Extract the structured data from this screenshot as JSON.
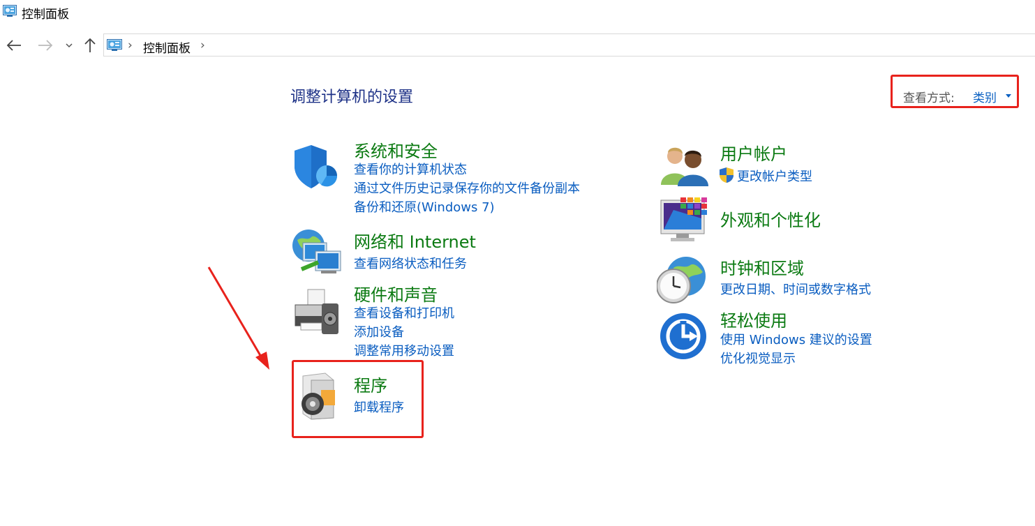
{
  "window": {
    "title": "控制面板"
  },
  "nav": {
    "breadcrumb": [
      "控制面板"
    ]
  },
  "main": {
    "page_title": "调整计算机的设置",
    "view_by": {
      "label": "查看方式:",
      "value": "类别"
    },
    "categories": [
      {
        "title": "系统和安全",
        "icon": "shield-icon",
        "links": [
          "查看你的计算机状态",
          "通过文件历史记录保存你的文件备份副本",
          "备份和还原(Windows 7)"
        ]
      },
      {
        "title": "网络和 Internet",
        "icon": "network-icon",
        "links": [
          "查看网络状态和任务"
        ]
      },
      {
        "title": "硬件和声音",
        "icon": "printer-icon",
        "links": [
          "查看设备和打印机",
          "添加设备",
          "调整常用移动设置"
        ]
      },
      {
        "title": "程序",
        "icon": "programs-icon",
        "links": [
          "卸载程序"
        ]
      },
      {
        "title": "用户帐户",
        "icon": "users-icon",
        "links": [
          "更改帐户类型"
        ]
      },
      {
        "title": "外观和个性化",
        "icon": "monitor-icon",
        "links": []
      },
      {
        "title": "时钟和区域",
        "icon": "clock-icon",
        "links": [
          "更改日期、时间或数字格式"
        ]
      },
      {
        "title": "轻松使用",
        "icon": "ease-of-access-icon",
        "links": [
          "使用 Windows 建议的设置",
          "优化视觉显示"
        ]
      }
    ]
  },
  "colors": {
    "accent_link": "#0a5dc0",
    "category_title": "#0b7a12",
    "page_title": "#1e3287",
    "annotation_red": "#e8221c"
  }
}
